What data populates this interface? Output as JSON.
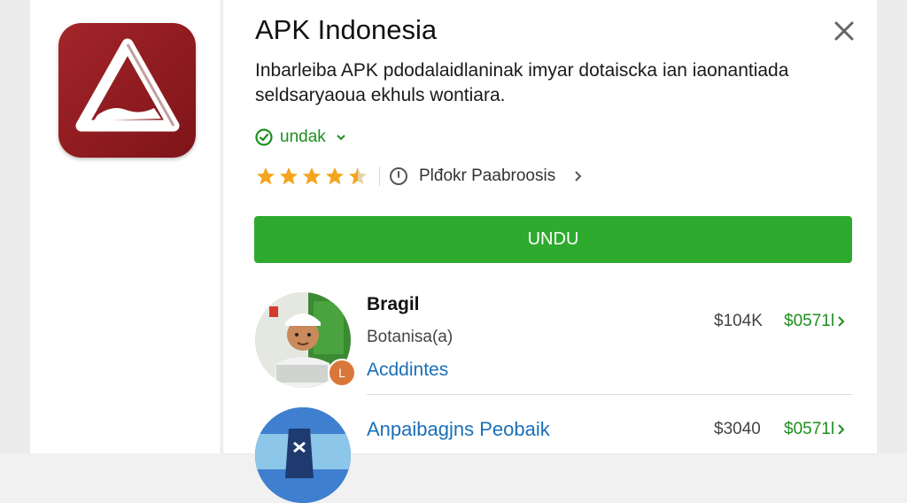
{
  "app": {
    "title": "APK Indonesia",
    "description": "Inbarleiba APK pdodalaidlaninak imyar dotaiscka ian iaonantiada seldsaryaoua ekhuls wontiara."
  },
  "download_status": {
    "label": "undak"
  },
  "rating": {
    "value": 4.5,
    "max": 5,
    "meta_label": "Plđokr Paabroosis"
  },
  "install_button": {
    "label": "UNDU"
  },
  "list": [
    {
      "name": "Bragil",
      "subtitle": "Botanisa(a)",
      "link": "Acddintes",
      "badge": "L",
      "price": "$104K",
      "price_action": "$0571l"
    },
    {
      "title": "Anpaibagjns Peobaik",
      "price": "$3040",
      "price_action": "$0571l"
    }
  ],
  "colors": {
    "accent_green": "#2eaa2e",
    "icon_red": "#a3252a",
    "link_blue": "#1a6fb8",
    "star": "#f3a51d"
  }
}
